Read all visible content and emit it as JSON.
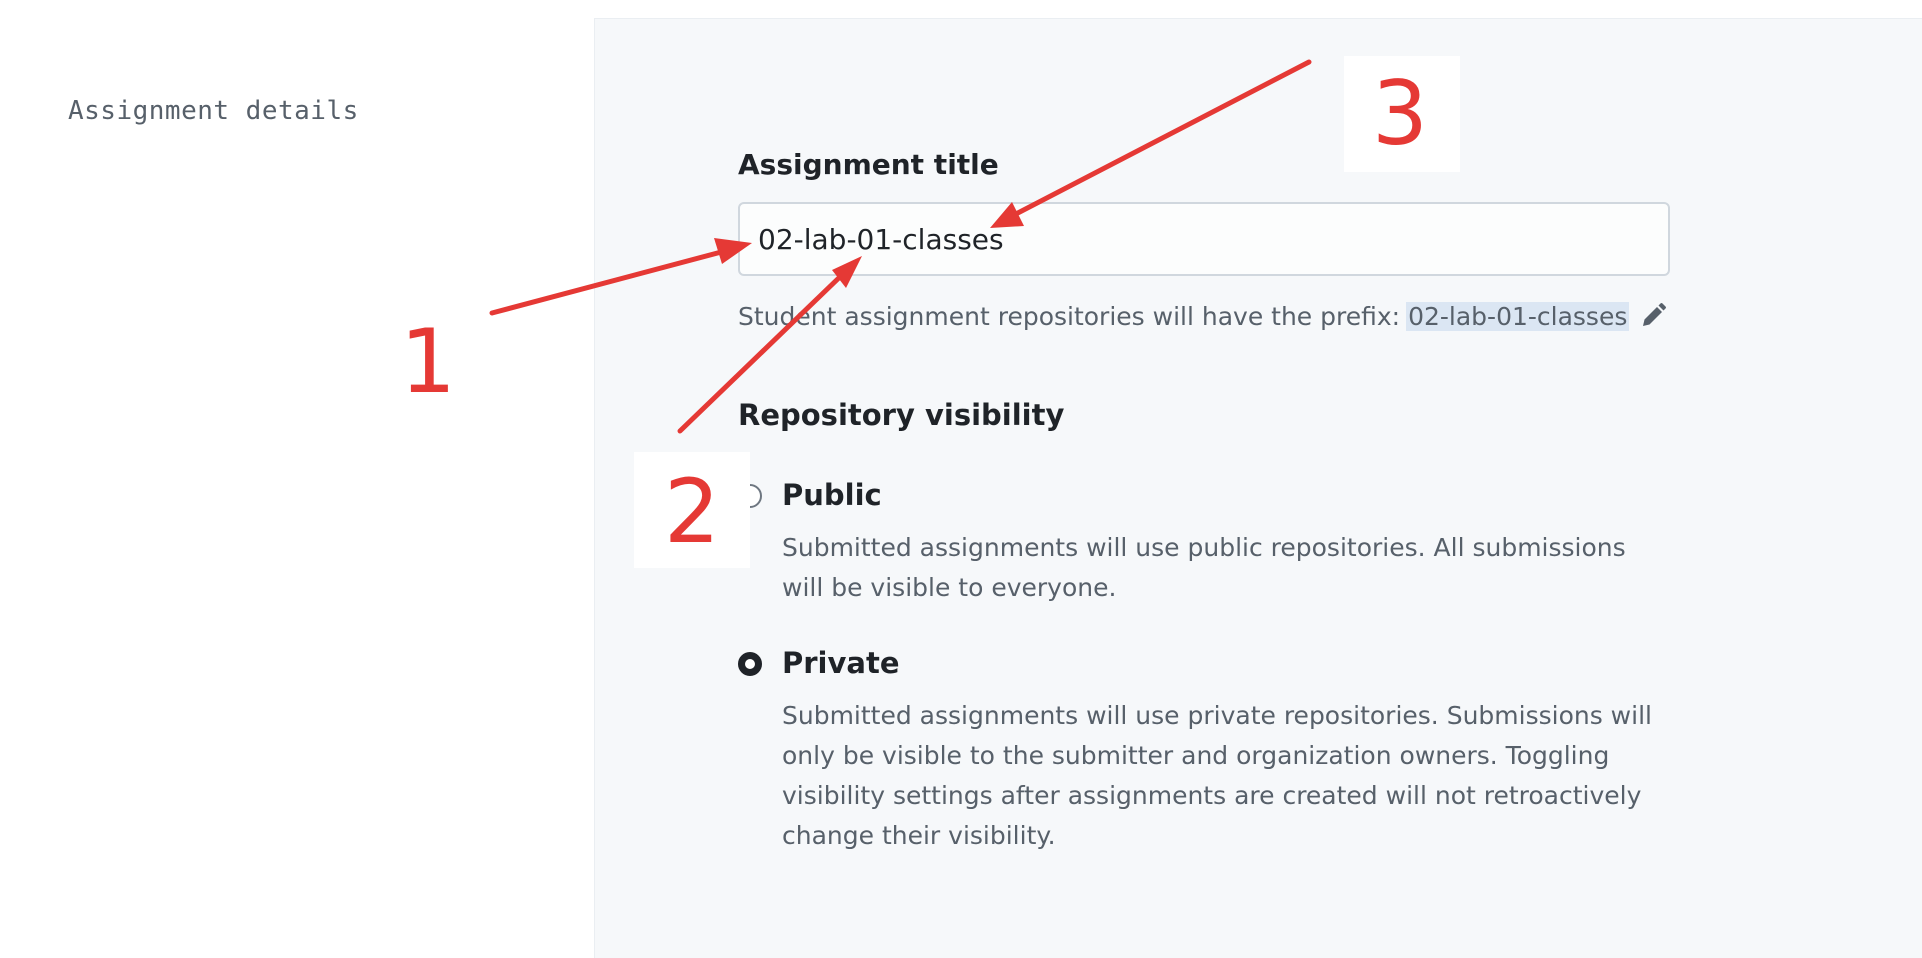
{
  "section": {
    "label": "Assignment details"
  },
  "form": {
    "title_label": "Assignment title",
    "title_value": "02-lab-01-classes",
    "prefix_text": "Student assignment repositories will have the prefix:",
    "prefix_value": "02-lab-01-classes",
    "edit_icon": "pencil-icon"
  },
  "visibility": {
    "heading": "Repository visibility",
    "options": [
      {
        "label": "Public",
        "description": "Submitted assignments will use public repositories. All submissions will be visible to everyone.",
        "selected": false
      },
      {
        "label": "Private",
        "description": "Submitted assignments will use private repositories. Submissions will only be visible to the submitter and organization owners. Toggling visibility settings after assignments are created will not retroactively change their visibility.",
        "selected": true
      }
    ]
  },
  "annotations": {
    "numbers": [
      "1",
      "2",
      "3"
    ],
    "color": "#e53935"
  }
}
